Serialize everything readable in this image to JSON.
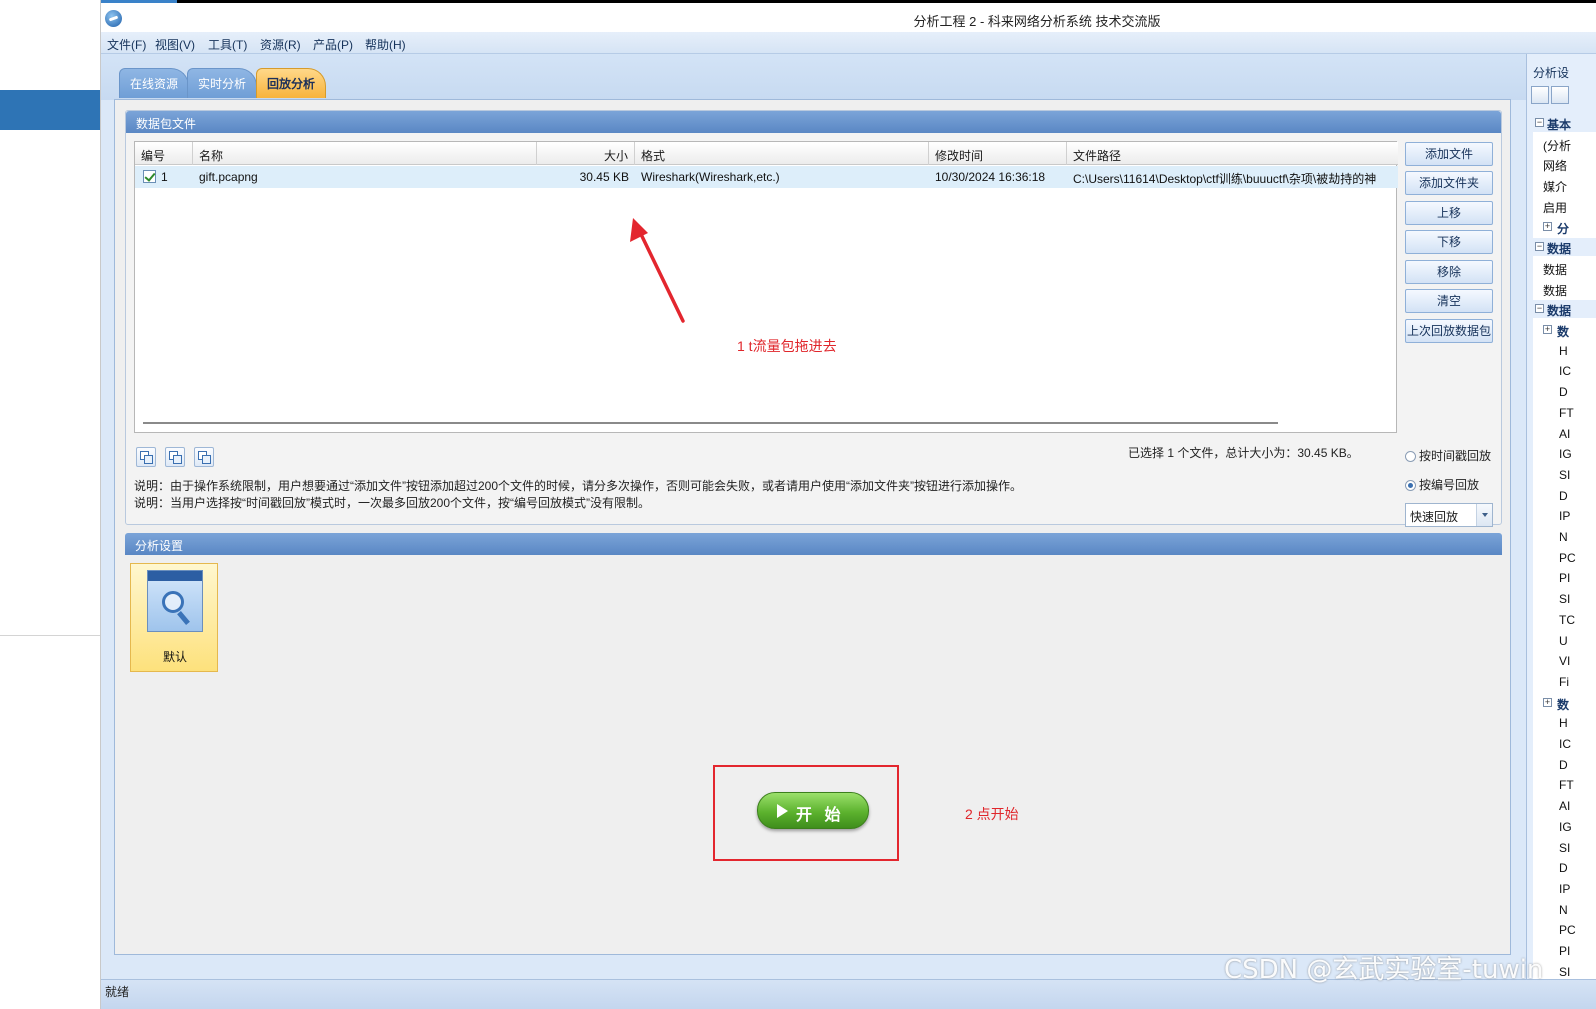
{
  "window": {
    "title": "分析工程 2 - 科来网络分析系统 技术交流版"
  },
  "menu": [
    "文件(F)",
    "视图(V)",
    "工具(T)",
    "资源(R)",
    "产品(P)",
    "帮助(H)"
  ],
  "tabs": [
    {
      "label": "在线资源",
      "active": false
    },
    {
      "label": "实时分析",
      "active": false
    },
    {
      "label": "回放分析",
      "active": true
    }
  ],
  "packet_section": {
    "title": "数据包文件",
    "columns": [
      "编号",
      "名称",
      "大小",
      "格式",
      "修改时间",
      "文件路径"
    ],
    "rows": [
      {
        "checked": true,
        "id": "1",
        "name": "gift.pcapng",
        "size": "30.45 KB",
        "format": "Wireshark(Wireshark,etc.)",
        "modified": "10/30/2024 16:36:18",
        "path": "C:\\Users\\11614\\Desktop\\ctf训练\\buuuctf\\杂项\\被劫持的神"
      }
    ],
    "buttons": [
      "添加文件",
      "添加文件夹",
      "上移",
      "下移",
      "移除",
      "清空",
      "上次回放数据包"
    ],
    "selection_info": "已选择 1 个文件，总计大小为：30.45 KB。",
    "note1": "说明：由于操作系统限制，用户想要通过“添加文件”按钮添加超过200个文件的时候，请分多次操作，否则可能会失败，或者请用户使用“添加文件夹”按钮进行添加操作。",
    "note2": "说明：当用户选择按“时间戳回放”模式时，一次最多回放200个文件，按“编号回放模式”没有限制。",
    "replay_modes": [
      {
        "label": "按时间戳回放",
        "selected": false
      },
      {
        "label": "按编号回放",
        "selected": true
      }
    ],
    "speed_select": "快速回放"
  },
  "analysis_section": {
    "title": "分析设置",
    "profile_label": "默认",
    "start_label": "开 始"
  },
  "annotations": {
    "step1": "1 t流量包拖进去",
    "step2": "2 点开始"
  },
  "right_pane": {
    "title": "分析设",
    "items": [
      {
        "type": "cat",
        "text": "基本"
      },
      {
        "type": "item",
        "text": "(分析"
      },
      {
        "type": "item",
        "text": "网络"
      },
      {
        "type": "item",
        "text": "媒介"
      },
      {
        "type": "item",
        "text": "启用"
      },
      {
        "type": "subcat",
        "text": "分"
      },
      {
        "type": "cat",
        "text": "数据"
      },
      {
        "type": "item",
        "text": "数据"
      },
      {
        "type": "item",
        "text": "数据"
      },
      {
        "type": "cat",
        "text": "数据"
      },
      {
        "type": "subcat",
        "text": "数"
      },
      {
        "type": "item",
        "text": "H"
      },
      {
        "type": "item",
        "text": "IC"
      },
      {
        "type": "item",
        "text": "D"
      },
      {
        "type": "item",
        "text": "FT"
      },
      {
        "type": "item",
        "text": "AI"
      },
      {
        "type": "item",
        "text": "IG"
      },
      {
        "type": "item",
        "text": "SI"
      },
      {
        "type": "item",
        "text": "D"
      },
      {
        "type": "item",
        "text": "IP"
      },
      {
        "type": "item",
        "text": "N"
      },
      {
        "type": "item",
        "text": "PC"
      },
      {
        "type": "item",
        "text": "PI"
      },
      {
        "type": "item",
        "text": "SI"
      },
      {
        "type": "item",
        "text": "TC"
      },
      {
        "type": "item",
        "text": "U"
      },
      {
        "type": "item",
        "text": "VI"
      },
      {
        "type": "item",
        "text": "Fi"
      },
      {
        "type": "subcat",
        "text": "数"
      },
      {
        "type": "item",
        "text": "H"
      },
      {
        "type": "item",
        "text": "IC"
      },
      {
        "type": "item",
        "text": "D"
      },
      {
        "type": "item",
        "text": "FT"
      },
      {
        "type": "item",
        "text": "AI"
      },
      {
        "type": "item",
        "text": "IG"
      },
      {
        "type": "item",
        "text": "SI"
      },
      {
        "type": "item",
        "text": "D"
      },
      {
        "type": "item",
        "text": "IP"
      },
      {
        "type": "item",
        "text": "N"
      },
      {
        "type": "item",
        "text": "PC"
      },
      {
        "type": "item",
        "text": "PI"
      },
      {
        "type": "item",
        "text": "SI"
      }
    ]
  },
  "status": "就绪",
  "watermark": "CSDN @玄武实验室-tuwin"
}
